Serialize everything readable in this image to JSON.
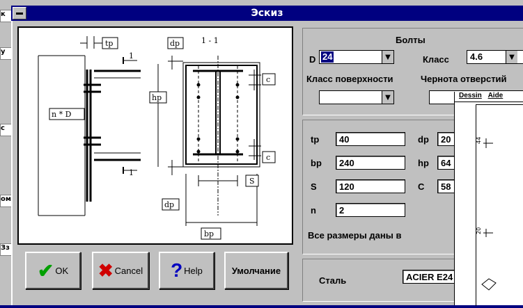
{
  "window": {
    "title": "Эскиз"
  },
  "background_strips": [
    "к",
    "у",
    "с",
    "ом",
    "Зз"
  ],
  "sketch": {
    "labels": {
      "tp": "tp",
      "one_top": "1",
      "dp_top": "dp",
      "section": "1 - 1",
      "hp": "hp",
      "nD": "n * D",
      "c_top": "c",
      "c_bottom": "c",
      "one_bottom": "1",
      "s": "S",
      "dp_bottom": "dp",
      "bp": "bp"
    }
  },
  "buttons": {
    "ok": "OK",
    "cancel": "Cancel",
    "help": "Help",
    "default": "Умолчание"
  },
  "bolts": {
    "title": "Болты",
    "d_label": "D",
    "d_value": "24",
    "class_label": "Класс",
    "class_value": "4.6",
    "surface_label": "Класс поверхности",
    "surface_value": "",
    "holes_label": "Чернота отверстий"
  },
  "dims": {
    "tp_label": "tp",
    "tp_value": "40",
    "bp_label": "bp",
    "bp_value": "240",
    "s_label": "S",
    "s_value": "120",
    "n_label": "n",
    "n_value": "2",
    "dp_label": "dp",
    "dp_value": "20",
    "hp_label": "hp",
    "hp_value": "64",
    "c_label": "C",
    "c_value": "58",
    "note": "Все размеры даны в"
  },
  "steel": {
    "label": "Сталь",
    "value": "ACIER E24"
  },
  "overlay": {
    "menu": [
      "Dessin",
      "Aide"
    ],
    "marks": [
      "44",
      "20"
    ]
  }
}
